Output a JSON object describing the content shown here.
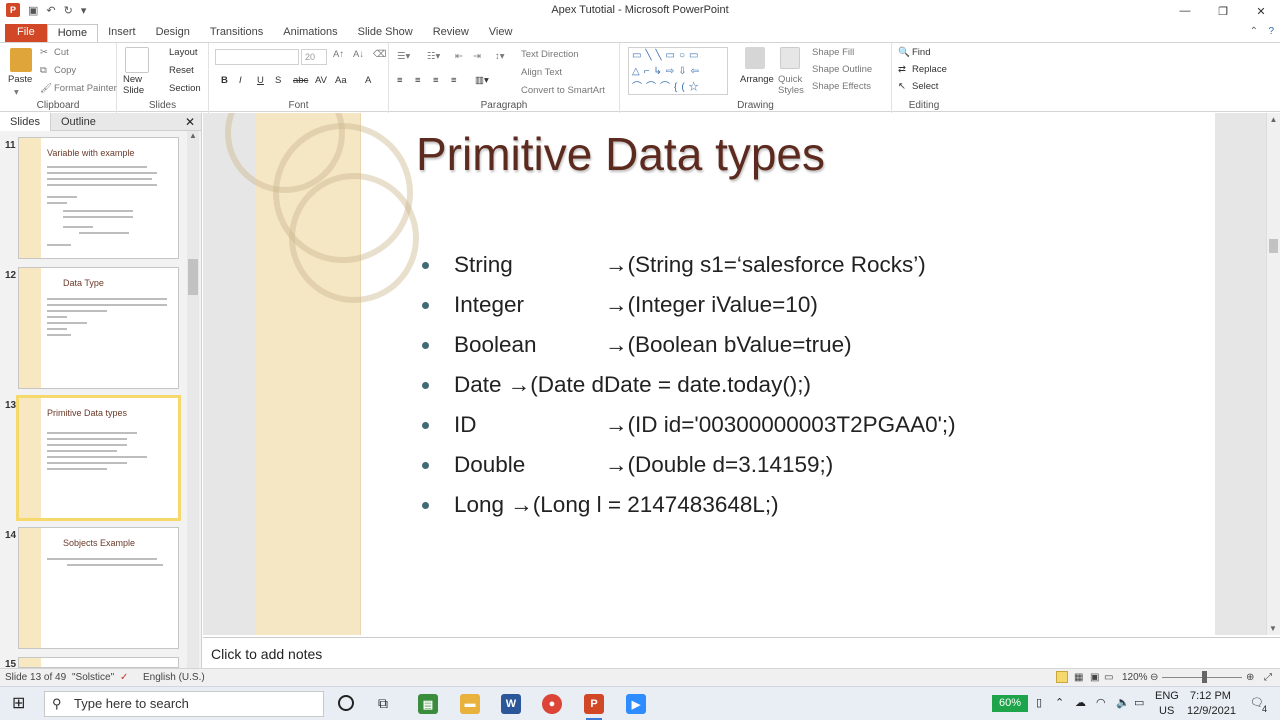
{
  "window": {
    "title": "Apex Tutotial  -  Microsoft PowerPoint"
  },
  "ribbon_tabs": [
    "File",
    "Home",
    "Insert",
    "Design",
    "Transitions",
    "Animations",
    "Slide Show",
    "Review",
    "View"
  ],
  "clipboard": {
    "paste": "Paste",
    "cut": "Cut",
    "copy": "Copy",
    "format_painter": "Format Painter",
    "label": "Clipboard"
  },
  "slides_group": {
    "new_slide": "New\nSlide",
    "layout": "Layout",
    "reset": "Reset",
    "section": "Section",
    "label": "Slides"
  },
  "font_group": {
    "size": "20",
    "label": "Font"
  },
  "paragraph": {
    "text_direction": "Text Direction",
    "align_text": "Align Text",
    "convert_smartart": "Convert to SmartArt",
    "label": "Paragraph"
  },
  "drawing": {
    "arrange": "Arrange",
    "quick_styles": "Quick\nStyles",
    "shape_fill": "Shape Fill",
    "shape_outline": "Shape Outline",
    "shape_effects": "Shape Effects",
    "label": "Drawing"
  },
  "editing": {
    "find": "Find",
    "replace": "Replace",
    "select": "Select",
    "label": "Editing"
  },
  "panel": {
    "tab_slides": "Slides",
    "tab_outline": "Outline"
  },
  "thumbnails": [
    {
      "num": "11",
      "title": "Variable  with example"
    },
    {
      "num": "12",
      "title": "Data Type"
    },
    {
      "num": "13",
      "title": "Primitive  Data types"
    },
    {
      "num": "14",
      "title": "Sobjects  Example"
    },
    {
      "num": "15",
      "title": ""
    }
  ],
  "slide": {
    "title": "Primitive Data types",
    "bullets": [
      {
        "name": "String",
        "code": "→(String s1=‘salesforce Rocks’)"
      },
      {
        "name": "Integer",
        "code": "→(Integer iValue=10)"
      },
      {
        "name": "Boolean",
        "code": "→(Boolean bValue=true)"
      },
      {
        "name": "Date →(Date  dDate = date.today();)",
        "code": ""
      },
      {
        "name": "ID",
        "code": "→(ID id='00300000003T2PGAA0';)"
      },
      {
        "name": "Double",
        "code": "→(Double d=3.14159;)"
      },
      {
        "name": "Long →(Long l = 2147483648L;)",
        "code": ""
      }
    ]
  },
  "notes": "Click to add notes",
  "status": {
    "slide": "Slide 13 of 49",
    "theme": "\"Solstice\"",
    "lang": "English (U.S.)",
    "zoom": "120%"
  },
  "taskbar": {
    "search": "Type here to search",
    "battery": "60%",
    "lang1": "ENG",
    "lang2": "US",
    "time": "7:12 PM",
    "date": "12/9/2021",
    "notif": "4"
  }
}
